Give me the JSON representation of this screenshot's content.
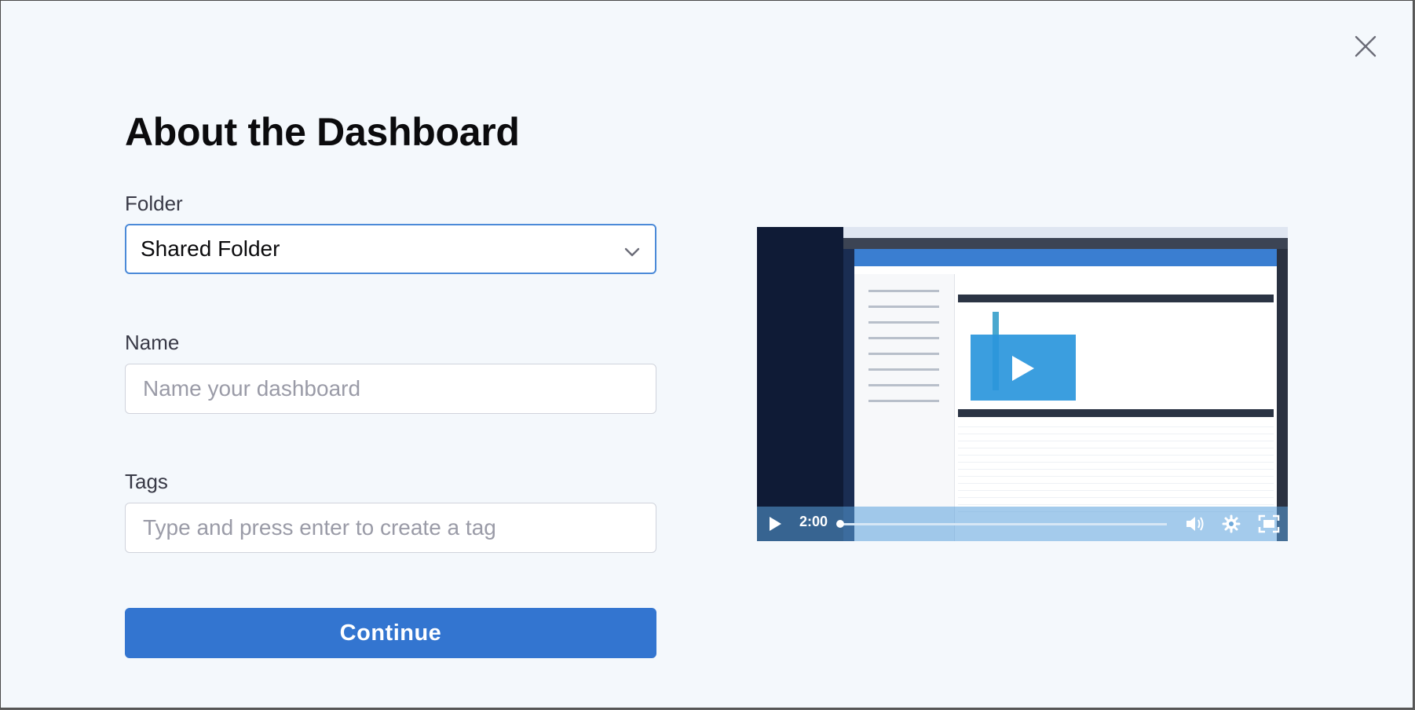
{
  "dialog": {
    "title": "About the Dashboard",
    "close_icon": "close-icon"
  },
  "form": {
    "folder": {
      "label": "Folder",
      "value": "Shared Folder",
      "icon": "chevron-down-icon"
    },
    "name": {
      "label": "Name",
      "placeholder": "Name your dashboard",
      "value": ""
    },
    "tags": {
      "label": "Tags",
      "placeholder": "Type and press enter to create a tag",
      "value": ""
    },
    "continue_label": "Continue"
  },
  "video": {
    "duration": "2:00",
    "icons": [
      "play-icon",
      "volume-icon",
      "settings-gear-icon",
      "fullscreen-icon"
    ],
    "accent_color": "#2a96dc"
  },
  "colors": {
    "primary": "#3375d0",
    "background": "#f4f8fc",
    "focus_border": "#4b8ad8"
  }
}
